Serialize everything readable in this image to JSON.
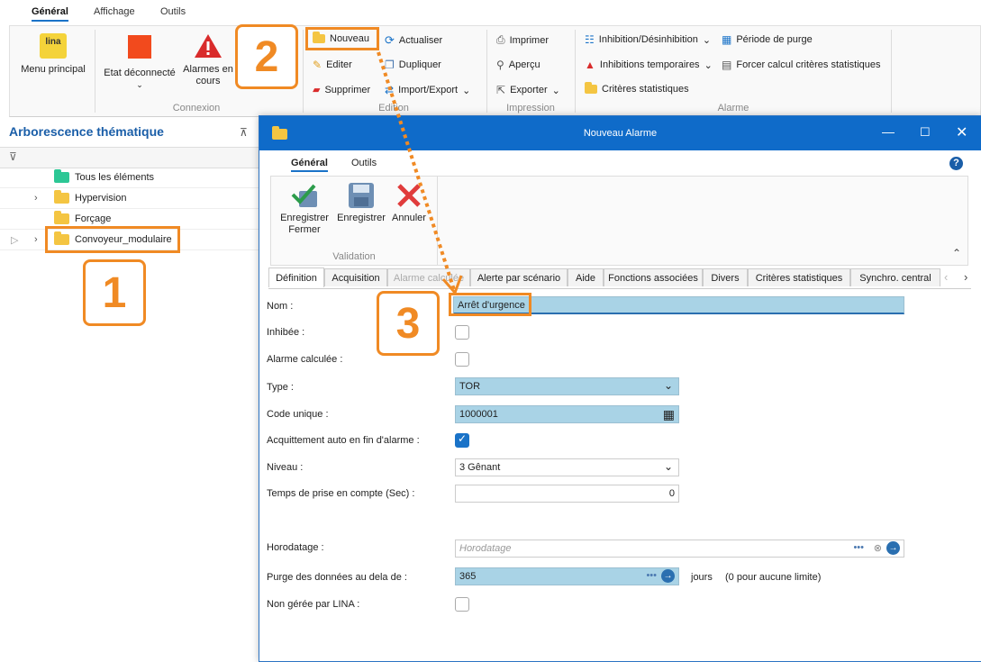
{
  "ribbon_tabs": [
    "Général",
    "Affichage",
    "Outils"
  ],
  "ribbon": {
    "menu_principal": "Menu principal",
    "etat": "Etat déconnecté",
    "alarmes": "Alarmes en cours",
    "connexion_label": "Connexion",
    "nouveau": "Nouveau",
    "actualiser": "Actualiser",
    "editer": "Editer",
    "dupliquer": "Dupliquer",
    "supprimer": "Supprimer",
    "import_export": "Import/Export",
    "edition_label": "Edition",
    "imprimer": "Imprimer",
    "apercu": "Aperçu",
    "exporter": "Exporter",
    "impression_label": "Impression",
    "inhibition": "Inhibition/Désinhibition",
    "inhibitions_temp": "Inhibitions temporaires",
    "criteres": "Critères statistiques",
    "periode_purge": "Période de purge",
    "forcer_calcul": "Forcer calcul critères statistiques",
    "alarme_label": "Alarme",
    "logo_text": "lina"
  },
  "tree": {
    "title": "Arborescence thématique",
    "items": [
      "Tous les éléments",
      "Hypervision",
      "Forçage",
      "Convoyeur_modulaire"
    ]
  },
  "dialog": {
    "title": "Nouveau Alarme",
    "tabs": [
      "Général",
      "Outils"
    ],
    "toolbar": {
      "save_close": "Enregistrer Fermer",
      "save": "Enregistrer",
      "cancel": "Annuler",
      "validation_label": "Validation"
    },
    "subtabs": [
      "Définition",
      "Acquisition",
      "Alarme calculée",
      "Alerte par scénario",
      "Aide",
      "Fonctions associées",
      "Divers",
      "Critères statistiques",
      "Synchro. central"
    ],
    "fields": {
      "nom_label": "Nom :",
      "nom_value": "Arrêt d'urgence",
      "inhibee_label": "Inhibée :",
      "alarme_calc_label": "Alarme calculée :",
      "type_label": "Type :",
      "type_value": "TOR",
      "code_label": "Code unique :",
      "code_value": "1000001",
      "acquittement_label": "Acquittement auto en fin d'alarme :",
      "niveau_label": "Niveau :",
      "niveau_value": "3 Gênant",
      "temps_label": "Temps de prise en compte (Sec) :",
      "temps_value": "0",
      "horodatage_label": "Horodatage :",
      "horodatage_placeholder": "Horodatage",
      "purge_label": "Purge des données au dela de :",
      "purge_value": "365",
      "purge_unit": "jours",
      "purge_hint": "(0 pour aucune limite)",
      "non_geree_label": "Non gérée par LINA :"
    }
  },
  "callouts": [
    "1",
    "2",
    "3"
  ],
  "colors": {
    "accent": "#f08a24",
    "titlebar": "#0f6bc9",
    "field_blue": "#a9d3e6"
  }
}
